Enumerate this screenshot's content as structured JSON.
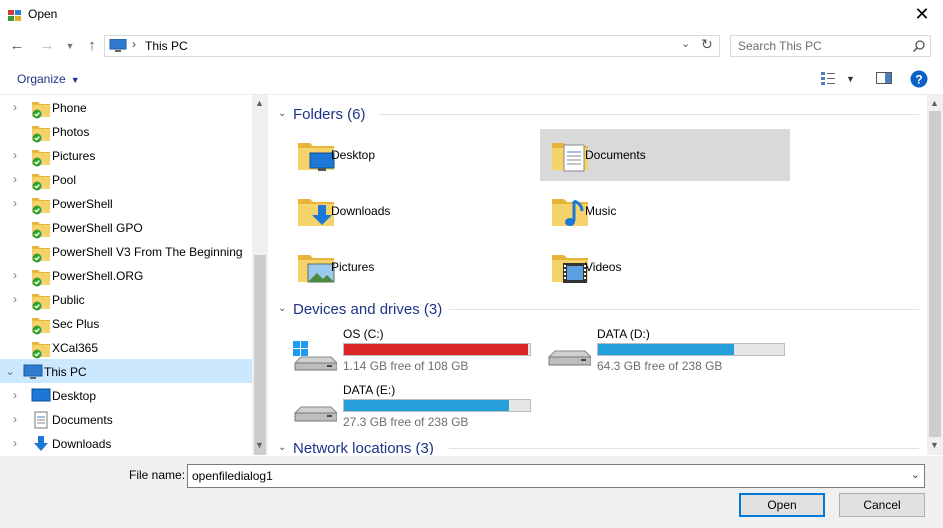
{
  "window": {
    "title": "Open",
    "close": "✕"
  },
  "address": {
    "crumb": "This PC",
    "separator": "›"
  },
  "search": {
    "placeholder": "Search This PC"
  },
  "toolbar": {
    "organize": "Organize"
  },
  "nav": {
    "items": [
      {
        "label": "Phone",
        "expandable": true,
        "icon": "folder-synced-icon"
      },
      {
        "label": "Photos",
        "expandable": false,
        "icon": "folder-synced-icon"
      },
      {
        "label": "Pictures",
        "expandable": true,
        "icon": "folder-synced-icon"
      },
      {
        "label": "Pool",
        "expandable": true,
        "icon": "folder-synced-icon"
      },
      {
        "label": "PowerShell",
        "expandable": true,
        "icon": "folder-synced-icon"
      },
      {
        "label": "PowerShell GPO",
        "expandable": false,
        "icon": "folder-synced-icon"
      },
      {
        "label": "PowerShell V3 From The Beginning",
        "expandable": false,
        "icon": "folder-synced-icon"
      },
      {
        "label": "PowerShell.ORG",
        "expandable": true,
        "icon": "folder-synced-icon"
      },
      {
        "label": "Public",
        "expandable": true,
        "icon": "folder-synced-icon"
      },
      {
        "label": "Sec Plus",
        "expandable": false,
        "icon": "folder-synced-icon"
      },
      {
        "label": "XCal365",
        "expandable": false,
        "icon": "folder-synced-icon"
      },
      {
        "label": "This PC",
        "expandable": true,
        "icon": "this-pc-icon"
      },
      {
        "label": "Desktop",
        "expandable": true,
        "icon": "desktop-icon"
      },
      {
        "label": "Documents",
        "expandable": true,
        "icon": "documents-icon"
      },
      {
        "label": "Downloads",
        "expandable": true,
        "icon": "downloads-icon"
      }
    ]
  },
  "content": {
    "folders_header": "Folders (6)",
    "folders": [
      {
        "label": "Desktop",
        "icon": "desktop-folder-icon"
      },
      {
        "label": "Documents",
        "icon": "documents-folder-icon"
      },
      {
        "label": "Downloads",
        "icon": "downloads-folder-icon"
      },
      {
        "label": "Music",
        "icon": "music-folder-icon"
      },
      {
        "label": "Pictures",
        "icon": "pictures-folder-icon"
      },
      {
        "label": "Videos",
        "icon": "videos-folder-icon"
      }
    ],
    "drives_header": "Devices and drives (3)",
    "drives": [
      {
        "name": "OS (C:)",
        "free": "1.14 GB free of 108 GB",
        "used_fraction": 0.989,
        "color": "#da2626",
        "icon": "windows-drive-icon"
      },
      {
        "name": "DATA (D:)",
        "free": "64.3 GB free of 238 GB",
        "used_fraction": 0.73,
        "color": "#26a0da",
        "icon": "hard-drive-icon"
      },
      {
        "name": "DATA (E:)",
        "free": "27.3 GB free of 238 GB",
        "used_fraction": 0.885,
        "color": "#26a0da",
        "icon": "hard-drive-icon"
      }
    ],
    "network_header": "Network locations (3)"
  },
  "filename": {
    "label": "File name:",
    "value": "openfiledialog1"
  },
  "buttons": {
    "open": "Open",
    "cancel": "Cancel"
  }
}
